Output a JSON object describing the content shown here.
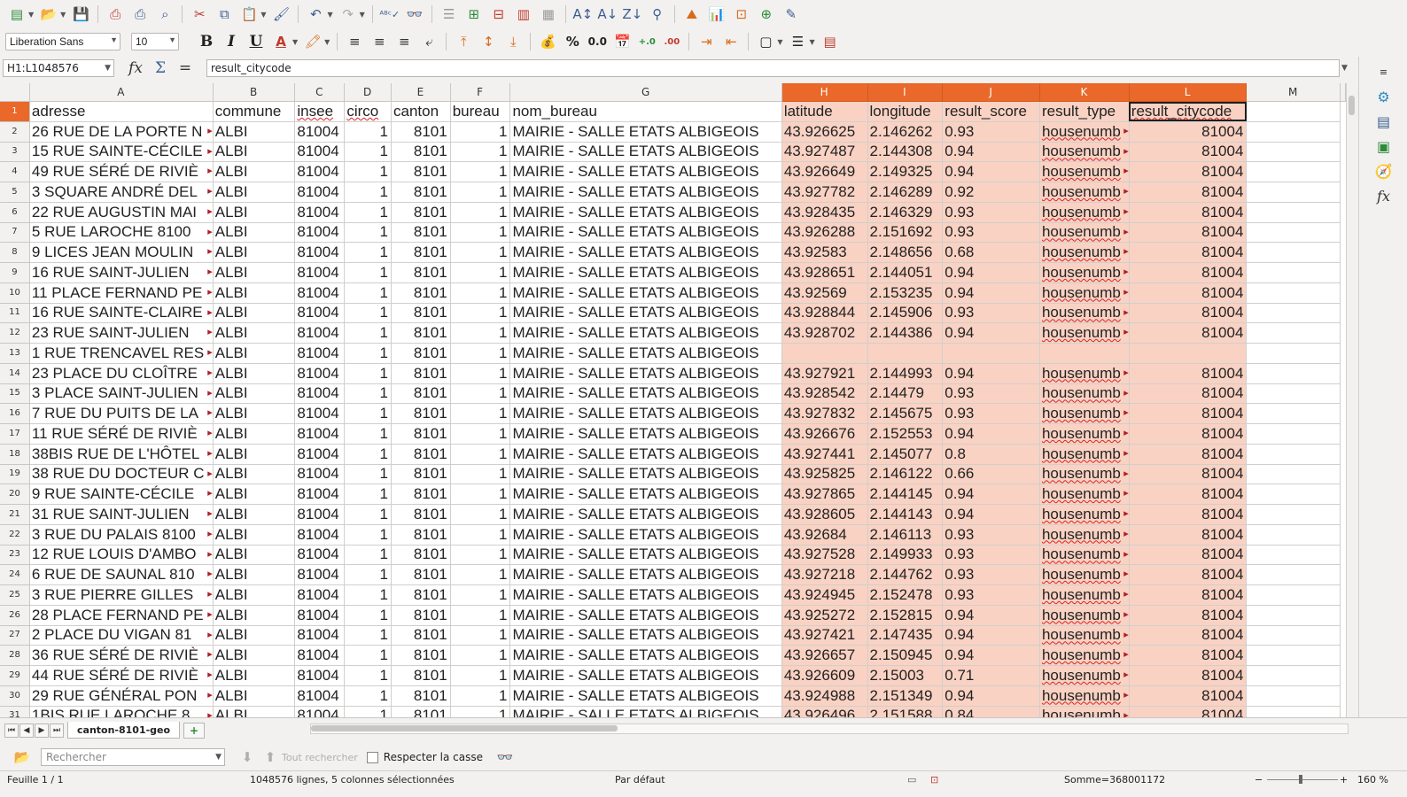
{
  "toolbar": {
    "font_name": "Liberation Sans",
    "font_size": "10",
    "bold_label": "B",
    "italic_label": "I",
    "underline_label": "U",
    "percent_label": "%",
    "decimal_label": "0.0",
    "add_decimal_label": "+0\n.000",
    "del_decimal_label": ".00\n.000"
  },
  "formula_bar": {
    "name_box": "H1:L1048576",
    "content": "result_citycode"
  },
  "columns": [
    "A",
    "B",
    "C",
    "D",
    "E",
    "F",
    "G",
    "H",
    "I",
    "J",
    "K",
    "L",
    "M"
  ],
  "selected_columns": [
    "H",
    "I",
    "J",
    "K",
    "L"
  ],
  "header_row": [
    "adresse",
    "commune",
    "insee",
    "circo",
    "canton",
    "bureau",
    "nom_bureau",
    "latitude",
    "longitude",
    "result_score",
    "result_type",
    "result_citycode"
  ],
  "rows": [
    {
      "n": "2",
      "a": "26  RUE DE LA PORTE N",
      "b": "ALBI",
      "c": "81004",
      "d": "1",
      "e": "8101",
      "f": "1",
      "g": "MAIRIE - SALLE ETATS ALBIGEOIS",
      "h": "43.926625",
      "i": "2.146262",
      "j": "0.93",
      "k": "housenumb",
      "l": "81004"
    },
    {
      "n": "3",
      "a": "15  RUE SAINTE-CÉCILE",
      "b": "ALBI",
      "c": "81004",
      "d": "1",
      "e": "8101",
      "f": "1",
      "g": "MAIRIE - SALLE ETATS ALBIGEOIS",
      "h": "43.927487",
      "i": "2.144308",
      "j": "0.94",
      "k": "housenumb",
      "l": "81004"
    },
    {
      "n": "4",
      "a": "49  RUE SÉRÉ DE RIVIÈ",
      "b": "ALBI",
      "c": "81004",
      "d": "1",
      "e": "8101",
      "f": "1",
      "g": "MAIRIE - SALLE ETATS ALBIGEOIS",
      "h": "43.926649",
      "i": "2.149325",
      "j": "0.94",
      "k": "housenumb",
      "l": "81004"
    },
    {
      "n": "5",
      "a": "3  SQUARE ANDRÉ DEL",
      "b": "ALBI",
      "c": "81004",
      "d": "1",
      "e": "8101",
      "f": "1",
      "g": "MAIRIE - SALLE ETATS ALBIGEOIS",
      "h": "43.927782",
      "i": "2.146289",
      "j": "0.92",
      "k": "housenumb",
      "l": "81004"
    },
    {
      "n": "6",
      "a": "22  RUE AUGUSTIN MAI",
      "b": "ALBI",
      "c": "81004",
      "d": "1",
      "e": "8101",
      "f": "1",
      "g": "MAIRIE - SALLE ETATS ALBIGEOIS",
      "h": "43.928435",
      "i": "2.146329",
      "j": "0.93",
      "k": "housenumb",
      "l": "81004"
    },
    {
      "n": "7",
      "a": "5  RUE LAROCHE  8100",
      "b": "ALBI",
      "c": "81004",
      "d": "1",
      "e": "8101",
      "f": "1",
      "g": "MAIRIE - SALLE ETATS ALBIGEOIS",
      "h": "43.926288",
      "i": "2.151692",
      "j": "0.93",
      "k": "housenumb",
      "l": "81004"
    },
    {
      "n": "8",
      "a": "9  LICES JEAN MOULIN",
      "b": "ALBI",
      "c": "81004",
      "d": "1",
      "e": "8101",
      "f": "1",
      "g": "MAIRIE - SALLE ETATS ALBIGEOIS",
      "h": "43.92583",
      "i": "2.148656",
      "j": "0.68",
      "k": "housenumb",
      "l": "81004"
    },
    {
      "n": "9",
      "a": "16  RUE SAINT-JULIEN",
      "b": "ALBI",
      "c": "81004",
      "d": "1",
      "e": "8101",
      "f": "1",
      "g": "MAIRIE - SALLE ETATS ALBIGEOIS",
      "h": "43.928651",
      "i": "2.144051",
      "j": "0.94",
      "k": "housenumb",
      "l": "81004"
    },
    {
      "n": "10",
      "a": "11  PLACE FERNAND PE",
      "b": "ALBI",
      "c": "81004",
      "d": "1",
      "e": "8101",
      "f": "1",
      "g": "MAIRIE - SALLE ETATS ALBIGEOIS",
      "h": "43.92569",
      "i": "2.153235",
      "j": "0.94",
      "k": "housenumb",
      "l": "81004"
    },
    {
      "n": "11",
      "a": "16  RUE SAINTE-CLAIRE",
      "b": "ALBI",
      "c": "81004",
      "d": "1",
      "e": "8101",
      "f": "1",
      "g": "MAIRIE - SALLE ETATS ALBIGEOIS",
      "h": "43.928844",
      "i": "2.145906",
      "j": "0.93",
      "k": "housenumb",
      "l": "81004"
    },
    {
      "n": "12",
      "a": "23  RUE SAINT-JULIEN",
      "b": "ALBI",
      "c": "81004",
      "d": "1",
      "e": "8101",
      "f": "1",
      "g": "MAIRIE - SALLE ETATS ALBIGEOIS",
      "h": "43.928702",
      "i": "2.144386",
      "j": "0.94",
      "k": "housenumb",
      "l": "81004"
    },
    {
      "n": "13",
      "a": "1  RUE TRENCAVEL RES",
      "b": "ALBI",
      "c": "81004",
      "d": "1",
      "e": "8101",
      "f": "1",
      "g": "MAIRIE - SALLE ETATS ALBIGEOIS",
      "h": "",
      "i": "",
      "j": "",
      "k": "",
      "l": ""
    },
    {
      "n": "14",
      "a": "23  PLACE DU CLOÎTRE",
      "b": "ALBI",
      "c": "81004",
      "d": "1",
      "e": "8101",
      "f": "1",
      "g": "MAIRIE - SALLE ETATS ALBIGEOIS",
      "h": "43.927921",
      "i": "2.144993",
      "j": "0.94",
      "k": "housenumb",
      "l": "81004"
    },
    {
      "n": "15",
      "a": "3  PLACE SAINT-JULIEN",
      "b": "ALBI",
      "c": "81004",
      "d": "1",
      "e": "8101",
      "f": "1",
      "g": "MAIRIE - SALLE ETATS ALBIGEOIS",
      "h": "43.928542",
      "i": "2.14479",
      "j": "0.93",
      "k": "housenumb",
      "l": "81004"
    },
    {
      "n": "16",
      "a": "7  RUE DU PUITS DE LA",
      "b": "ALBI",
      "c": "81004",
      "d": "1",
      "e": "8101",
      "f": "1",
      "g": "MAIRIE - SALLE ETATS ALBIGEOIS",
      "h": "43.927832",
      "i": "2.145675",
      "j": "0.93",
      "k": "housenumb",
      "l": "81004"
    },
    {
      "n": "17",
      "a": "11  RUE SÉRÉ DE RIVIÈ",
      "b": "ALBI",
      "c": "81004",
      "d": "1",
      "e": "8101",
      "f": "1",
      "g": "MAIRIE - SALLE ETATS ALBIGEOIS",
      "h": "43.926676",
      "i": "2.152553",
      "j": "0.94",
      "k": "housenumb",
      "l": "81004"
    },
    {
      "n": "18",
      "a": "38BIS  RUE DE L'HÔTEL",
      "b": "ALBI",
      "c": "81004",
      "d": "1",
      "e": "8101",
      "f": "1",
      "g": "MAIRIE - SALLE ETATS ALBIGEOIS",
      "h": "43.927441",
      "i": "2.145077",
      "j": "0.8",
      "k": "housenumb",
      "l": "81004"
    },
    {
      "n": "19",
      "a": "38  RUE DU DOCTEUR C",
      "b": "ALBI",
      "c": "81004",
      "d": "1",
      "e": "8101",
      "f": "1",
      "g": "MAIRIE - SALLE ETATS ALBIGEOIS",
      "h": "43.925825",
      "i": "2.146122",
      "j": "0.66",
      "k": "housenumb",
      "l": "81004"
    },
    {
      "n": "20",
      "a": "9  RUE SAINTE-CÉCILE",
      "b": "ALBI",
      "c": "81004",
      "d": "1",
      "e": "8101",
      "f": "1",
      "g": "MAIRIE - SALLE ETATS ALBIGEOIS",
      "h": "43.927865",
      "i": "2.144145",
      "j": "0.94",
      "k": "housenumb",
      "l": "81004"
    },
    {
      "n": "21",
      "a": "31  RUE SAINT-JULIEN",
      "b": "ALBI",
      "c": "81004",
      "d": "1",
      "e": "8101",
      "f": "1",
      "g": "MAIRIE - SALLE ETATS ALBIGEOIS",
      "h": "43.928605",
      "i": "2.144143",
      "j": "0.94",
      "k": "housenumb",
      "l": "81004"
    },
    {
      "n": "22",
      "a": "3  RUE DU PALAIS  8100",
      "b": "ALBI",
      "c": "81004",
      "d": "1",
      "e": "8101",
      "f": "1",
      "g": "MAIRIE - SALLE ETATS ALBIGEOIS",
      "h": "43.92684",
      "i": "2.146113",
      "j": "0.93",
      "k": "housenumb",
      "l": "81004"
    },
    {
      "n": "23",
      "a": "12  RUE LOUIS D'AMBO",
      "b": "ALBI",
      "c": "81004",
      "d": "1",
      "e": "8101",
      "f": "1",
      "g": "MAIRIE - SALLE ETATS ALBIGEOIS",
      "h": "43.927528",
      "i": "2.149933",
      "j": "0.93",
      "k": "housenumb",
      "l": "81004"
    },
    {
      "n": "24",
      "a": "6  RUE DE SAUNAL  810",
      "b": "ALBI",
      "c": "81004",
      "d": "1",
      "e": "8101",
      "f": "1",
      "g": "MAIRIE - SALLE ETATS ALBIGEOIS",
      "h": "43.927218",
      "i": "2.144762",
      "j": "0.93",
      "k": "housenumb",
      "l": "81004"
    },
    {
      "n": "25",
      "a": "3  RUE PIERRE GILLES",
      "b": "ALBI",
      "c": "81004",
      "d": "1",
      "e": "8101",
      "f": "1",
      "g": "MAIRIE - SALLE ETATS ALBIGEOIS",
      "h": "43.924945",
      "i": "2.152478",
      "j": "0.93",
      "k": "housenumb",
      "l": "81004"
    },
    {
      "n": "26",
      "a": "28  PLACE FERNAND PE",
      "b": "ALBI",
      "c": "81004",
      "d": "1",
      "e": "8101",
      "f": "1",
      "g": "MAIRIE - SALLE ETATS ALBIGEOIS",
      "h": "43.925272",
      "i": "2.152815",
      "j": "0.94",
      "k": "housenumb",
      "l": "81004"
    },
    {
      "n": "27",
      "a": "2  PLACE DU VIGAN  81",
      "b": "ALBI",
      "c": "81004",
      "d": "1",
      "e": "8101",
      "f": "1",
      "g": "MAIRIE - SALLE ETATS ALBIGEOIS",
      "h": "43.927421",
      "i": "2.147435",
      "j": "0.94",
      "k": "housenumb",
      "l": "81004"
    },
    {
      "n": "28",
      "a": "36  RUE SÉRÉ DE RIVIÈ",
      "b": "ALBI",
      "c": "81004",
      "d": "1",
      "e": "8101",
      "f": "1",
      "g": "MAIRIE - SALLE ETATS ALBIGEOIS",
      "h": "43.926657",
      "i": "2.150945",
      "j": "0.94",
      "k": "housenumb",
      "l": "81004"
    },
    {
      "n": "29",
      "a": "44  RUE SÉRÉ DE RIVIÈ",
      "b": "ALBI",
      "c": "81004",
      "d": "1",
      "e": "8101",
      "f": "1",
      "g": "MAIRIE - SALLE ETATS ALBIGEOIS",
      "h": "43.926609",
      "i": "2.15003",
      "j": "0.71",
      "k": "housenumb",
      "l": "81004"
    },
    {
      "n": "30",
      "a": "29  RUE GÉNÉRAL PON",
      "b": "ALBI",
      "c": "81004",
      "d": "1",
      "e": "8101",
      "f": "1",
      "g": "MAIRIE - SALLE ETATS ALBIGEOIS",
      "h": "43.924988",
      "i": "2.151349",
      "j": "0.94",
      "k": "housenumb",
      "l": "81004"
    },
    {
      "n": "31",
      "a": "1BIS  RUE LAROCHE  8",
      "b": "ALBI",
      "c": "81004",
      "d": "1",
      "e": "8101",
      "f": "1",
      "g": "MAIRIE - SALLE ETATS ALBIGEOIS",
      "h": "43.926496",
      "i": "2.151588",
      "j": "0.84",
      "k": "housenumb",
      "l": "81004"
    }
  ],
  "sheet_tab": "canton-8101-geo",
  "find": {
    "placeholder": "Rechercher",
    "find_all": "Tout rechercher",
    "match_case": "Respecter la casse"
  },
  "status": {
    "sheet": "Feuille 1 / 1",
    "selection": "1048576 lignes, 5 colonnes sélectionnées",
    "style": "Par défaut",
    "sum": "Somme=368001172",
    "zoom": "160 %"
  }
}
